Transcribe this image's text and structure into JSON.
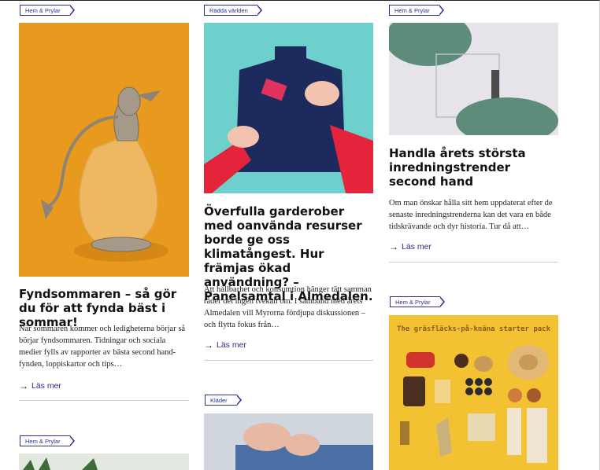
{
  "col1": {
    "tag": "Hem & Prylar",
    "title": "Fyndsommaren – så gör du för att fynda bäst i sommar!",
    "excerpt": "När sommaren kommer och ledigheterna börjar så börjar fyndsommaren. Tidningar och sociala medier fylls av rapporter av bästa second hand-fynden, loppiskartor och tips…",
    "more": "Läs mer",
    "tag2": "Hem & Prylar"
  },
  "col2": {
    "tag": "Rädda världen",
    "title": "Överfulla garderober med oanvända resurser borde ge oss klimatångest. Hur främjas ökad användning? – Panelsamtal i Almedalen.",
    "excerpt": "Att hållbarhet och konsumtion hänger tätt samman råder det ingen tvekan om. I samband med årets Almedalen vill Myrorna fördjupa diskussionen – och flytta fokus från…",
    "more": "Läs mer",
    "tag2": "Kläder"
  },
  "col3": {
    "tag": "Hem & Prylar",
    "title": "Handla årets största inredningstrender second hand",
    "excerpt": "Om man önskar hålla sitt hem uppdaterat efter de senaste inredningstrenderna kan det vara en både tidskrävande och dyr historia. Tur då att…",
    "more": "Läs mer",
    "tag2": "Hem & Prylar",
    "poster_text": "The gräsfläcks-på-knäna starter pack"
  },
  "colors": {
    "accent": "#2a2f8a",
    "orange_bg": "#e89a1e",
    "teal_bg": "#6ed0cc",
    "yellow_bg": "#f2c233"
  }
}
